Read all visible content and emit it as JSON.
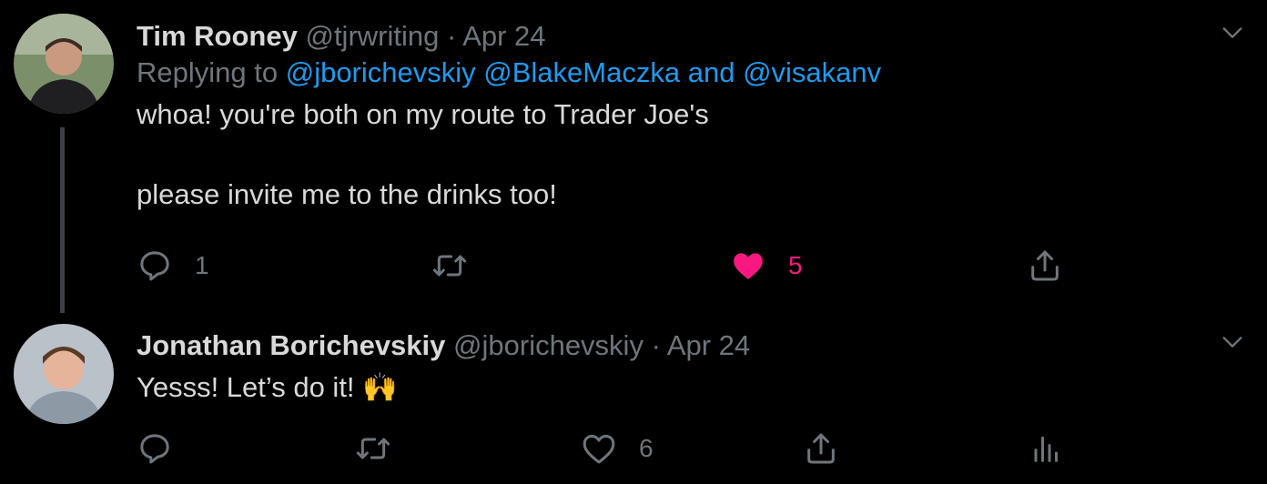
{
  "tweets": [
    {
      "name": "Tim Rooney",
      "handle": "@tjrwriting",
      "separator": "·",
      "date": "Apr 24",
      "replying_prefix": "Replying to",
      "mentions": [
        "@jborichevskiy",
        "@BlakeMaczka"
      ],
      "mentions_and": "and",
      "mention_last": "@visakanv",
      "text_line1": "whoa! you're both on my route to Trader Joe's",
      "text_line2": "please invite me to the drinks too!",
      "reply_count": "1",
      "like_count": "5",
      "liked": true
    },
    {
      "name": "Jonathan Borichevskiy",
      "handle": "@jborichevskiy",
      "separator": "·",
      "date": "Apr 24",
      "text": "Yesss! Let’s do it! 🙌",
      "like_count": "6",
      "liked": false
    }
  ],
  "colors": {
    "background": "#000000",
    "text": "#d9d9d9",
    "muted": "#6e767d",
    "link": "#1d9bf0",
    "like": "#f91880"
  },
  "icons": [
    "reply-icon",
    "retweet-icon",
    "like-icon",
    "share-icon",
    "analytics-icon",
    "caret-down-icon"
  ]
}
